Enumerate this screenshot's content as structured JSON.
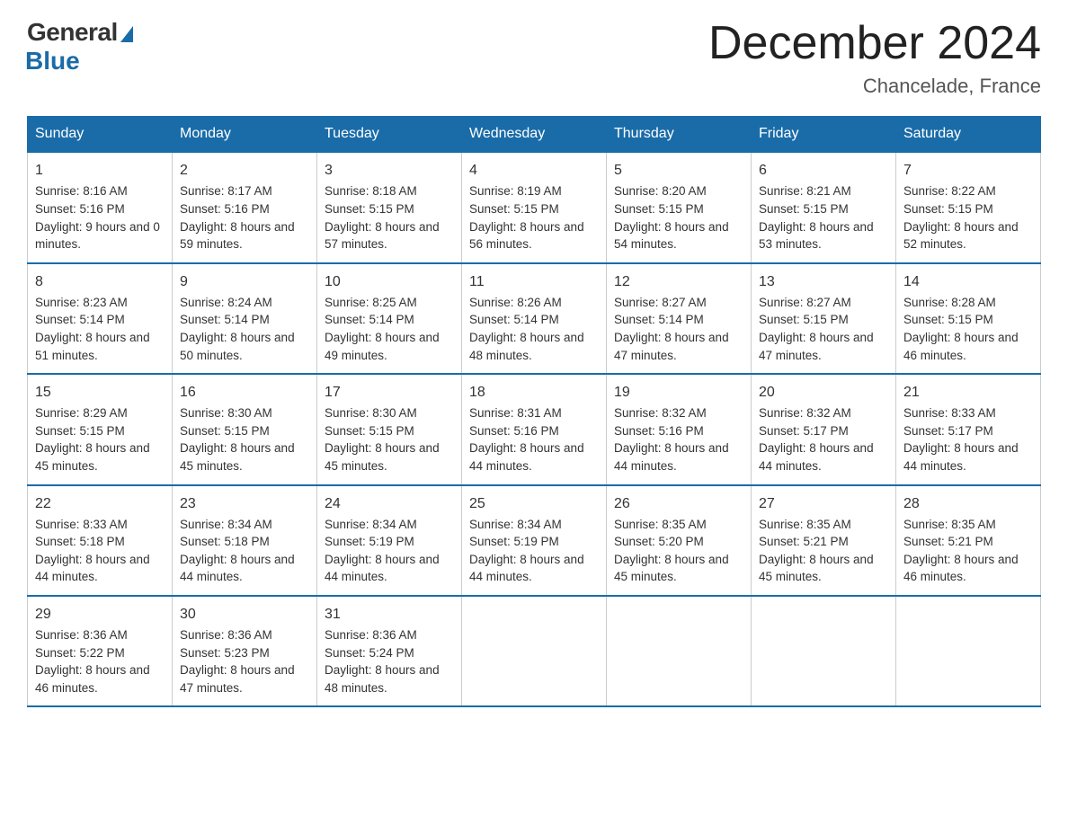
{
  "logo": {
    "general": "General",
    "blue": "Blue"
  },
  "title": "December 2024",
  "subtitle": "Chancelade, France",
  "days": [
    "Sunday",
    "Monday",
    "Tuesday",
    "Wednesday",
    "Thursday",
    "Friday",
    "Saturday"
  ],
  "weeks": [
    [
      {
        "num": "1",
        "sunrise": "8:16 AM",
        "sunset": "5:16 PM",
        "daylight": "9 hours and 0 minutes."
      },
      {
        "num": "2",
        "sunrise": "8:17 AM",
        "sunset": "5:16 PM",
        "daylight": "8 hours and 59 minutes."
      },
      {
        "num": "3",
        "sunrise": "8:18 AM",
        "sunset": "5:15 PM",
        "daylight": "8 hours and 57 minutes."
      },
      {
        "num": "4",
        "sunrise": "8:19 AM",
        "sunset": "5:15 PM",
        "daylight": "8 hours and 56 minutes."
      },
      {
        "num": "5",
        "sunrise": "8:20 AM",
        "sunset": "5:15 PM",
        "daylight": "8 hours and 54 minutes."
      },
      {
        "num": "6",
        "sunrise": "8:21 AM",
        "sunset": "5:15 PM",
        "daylight": "8 hours and 53 minutes."
      },
      {
        "num": "7",
        "sunrise": "8:22 AM",
        "sunset": "5:15 PM",
        "daylight": "8 hours and 52 minutes."
      }
    ],
    [
      {
        "num": "8",
        "sunrise": "8:23 AM",
        "sunset": "5:14 PM",
        "daylight": "8 hours and 51 minutes."
      },
      {
        "num": "9",
        "sunrise": "8:24 AM",
        "sunset": "5:14 PM",
        "daylight": "8 hours and 50 minutes."
      },
      {
        "num": "10",
        "sunrise": "8:25 AM",
        "sunset": "5:14 PM",
        "daylight": "8 hours and 49 minutes."
      },
      {
        "num": "11",
        "sunrise": "8:26 AM",
        "sunset": "5:14 PM",
        "daylight": "8 hours and 48 minutes."
      },
      {
        "num": "12",
        "sunrise": "8:27 AM",
        "sunset": "5:14 PM",
        "daylight": "8 hours and 47 minutes."
      },
      {
        "num": "13",
        "sunrise": "8:27 AM",
        "sunset": "5:15 PM",
        "daylight": "8 hours and 47 minutes."
      },
      {
        "num": "14",
        "sunrise": "8:28 AM",
        "sunset": "5:15 PM",
        "daylight": "8 hours and 46 minutes."
      }
    ],
    [
      {
        "num": "15",
        "sunrise": "8:29 AM",
        "sunset": "5:15 PM",
        "daylight": "8 hours and 45 minutes."
      },
      {
        "num": "16",
        "sunrise": "8:30 AM",
        "sunset": "5:15 PM",
        "daylight": "8 hours and 45 minutes."
      },
      {
        "num": "17",
        "sunrise": "8:30 AM",
        "sunset": "5:15 PM",
        "daylight": "8 hours and 45 minutes."
      },
      {
        "num": "18",
        "sunrise": "8:31 AM",
        "sunset": "5:16 PM",
        "daylight": "8 hours and 44 minutes."
      },
      {
        "num": "19",
        "sunrise": "8:32 AM",
        "sunset": "5:16 PM",
        "daylight": "8 hours and 44 minutes."
      },
      {
        "num": "20",
        "sunrise": "8:32 AM",
        "sunset": "5:17 PM",
        "daylight": "8 hours and 44 minutes."
      },
      {
        "num": "21",
        "sunrise": "8:33 AM",
        "sunset": "5:17 PM",
        "daylight": "8 hours and 44 minutes."
      }
    ],
    [
      {
        "num": "22",
        "sunrise": "8:33 AM",
        "sunset": "5:18 PM",
        "daylight": "8 hours and 44 minutes."
      },
      {
        "num": "23",
        "sunrise": "8:34 AM",
        "sunset": "5:18 PM",
        "daylight": "8 hours and 44 minutes."
      },
      {
        "num": "24",
        "sunrise": "8:34 AM",
        "sunset": "5:19 PM",
        "daylight": "8 hours and 44 minutes."
      },
      {
        "num": "25",
        "sunrise": "8:34 AM",
        "sunset": "5:19 PM",
        "daylight": "8 hours and 44 minutes."
      },
      {
        "num": "26",
        "sunrise": "8:35 AM",
        "sunset": "5:20 PM",
        "daylight": "8 hours and 45 minutes."
      },
      {
        "num": "27",
        "sunrise": "8:35 AM",
        "sunset": "5:21 PM",
        "daylight": "8 hours and 45 minutes."
      },
      {
        "num": "28",
        "sunrise": "8:35 AM",
        "sunset": "5:21 PM",
        "daylight": "8 hours and 46 minutes."
      }
    ],
    [
      {
        "num": "29",
        "sunrise": "8:36 AM",
        "sunset": "5:22 PM",
        "daylight": "8 hours and 46 minutes."
      },
      {
        "num": "30",
        "sunrise": "8:36 AM",
        "sunset": "5:23 PM",
        "daylight": "8 hours and 47 minutes."
      },
      {
        "num": "31",
        "sunrise": "8:36 AM",
        "sunset": "5:24 PM",
        "daylight": "8 hours and 48 minutes."
      },
      null,
      null,
      null,
      null
    ]
  ],
  "labels": {
    "sunrise": "Sunrise:",
    "sunset": "Sunset:",
    "daylight": "Daylight:"
  }
}
